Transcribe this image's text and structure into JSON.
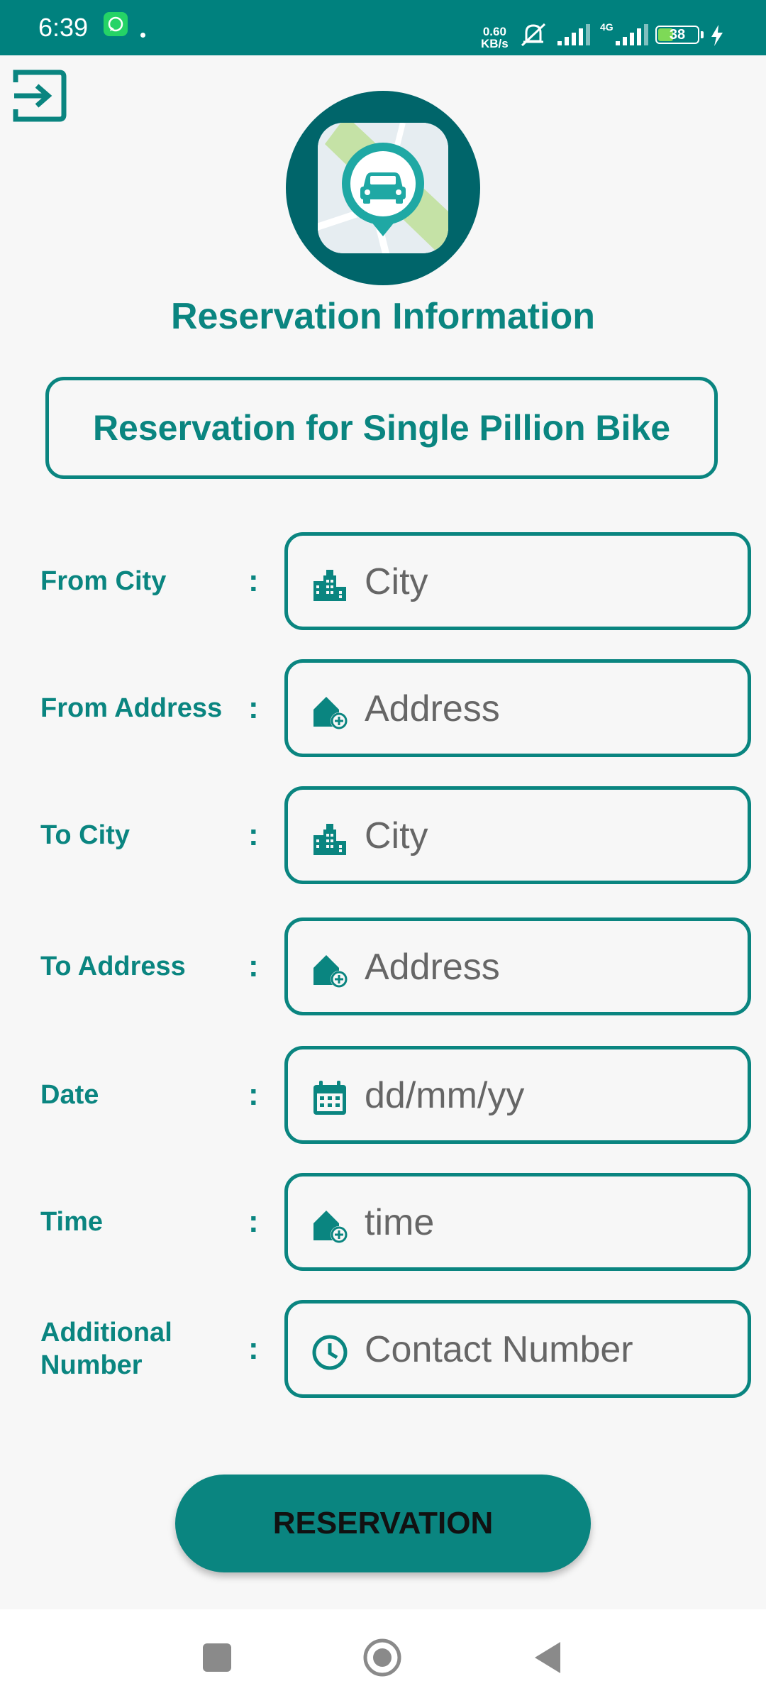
{
  "status_bar": {
    "time": "6:39",
    "net_speed_value": "0.60",
    "net_speed_unit": "KB/s",
    "network_type": "4G",
    "battery_level": "38",
    "battery_fraction": 0.38,
    "icons": [
      "whatsapp-icon",
      "bell-off-icon",
      "signal-icon",
      "signal-icon",
      "battery-icon",
      "charging-icon"
    ]
  },
  "header": {
    "exit_icon": "exit-icon",
    "logo_icon": "car-location-pin-icon",
    "title": "Reservation Information",
    "subtitle": "Reservation for Single Pillion Bike"
  },
  "form": {
    "colon": ":",
    "rows": [
      {
        "label": "From City",
        "icon": "city-icon",
        "placeholder": "City"
      },
      {
        "label": "From Address",
        "icon": "add-home-icon",
        "placeholder": "Address"
      },
      {
        "label": "To City",
        "icon": "city-icon",
        "placeholder": "City"
      },
      {
        "label": "To Address",
        "icon": "add-home-icon",
        "placeholder": "Address"
      },
      {
        "label": "Date",
        "icon": "calendar-icon",
        "placeholder": "dd/mm/yy"
      },
      {
        "label": "Time",
        "icon": "add-home-icon",
        "placeholder": "time"
      },
      {
        "label": "Additional Number",
        "icon": "clock-icon",
        "placeholder": "Contact Number"
      }
    ]
  },
  "actions": {
    "reservation_label": "RESERVATION"
  },
  "colors": {
    "primary": "#0a8580",
    "status_bar": "#00817e",
    "logo_bg": "#00656a",
    "background": "#f7f7f7"
  }
}
